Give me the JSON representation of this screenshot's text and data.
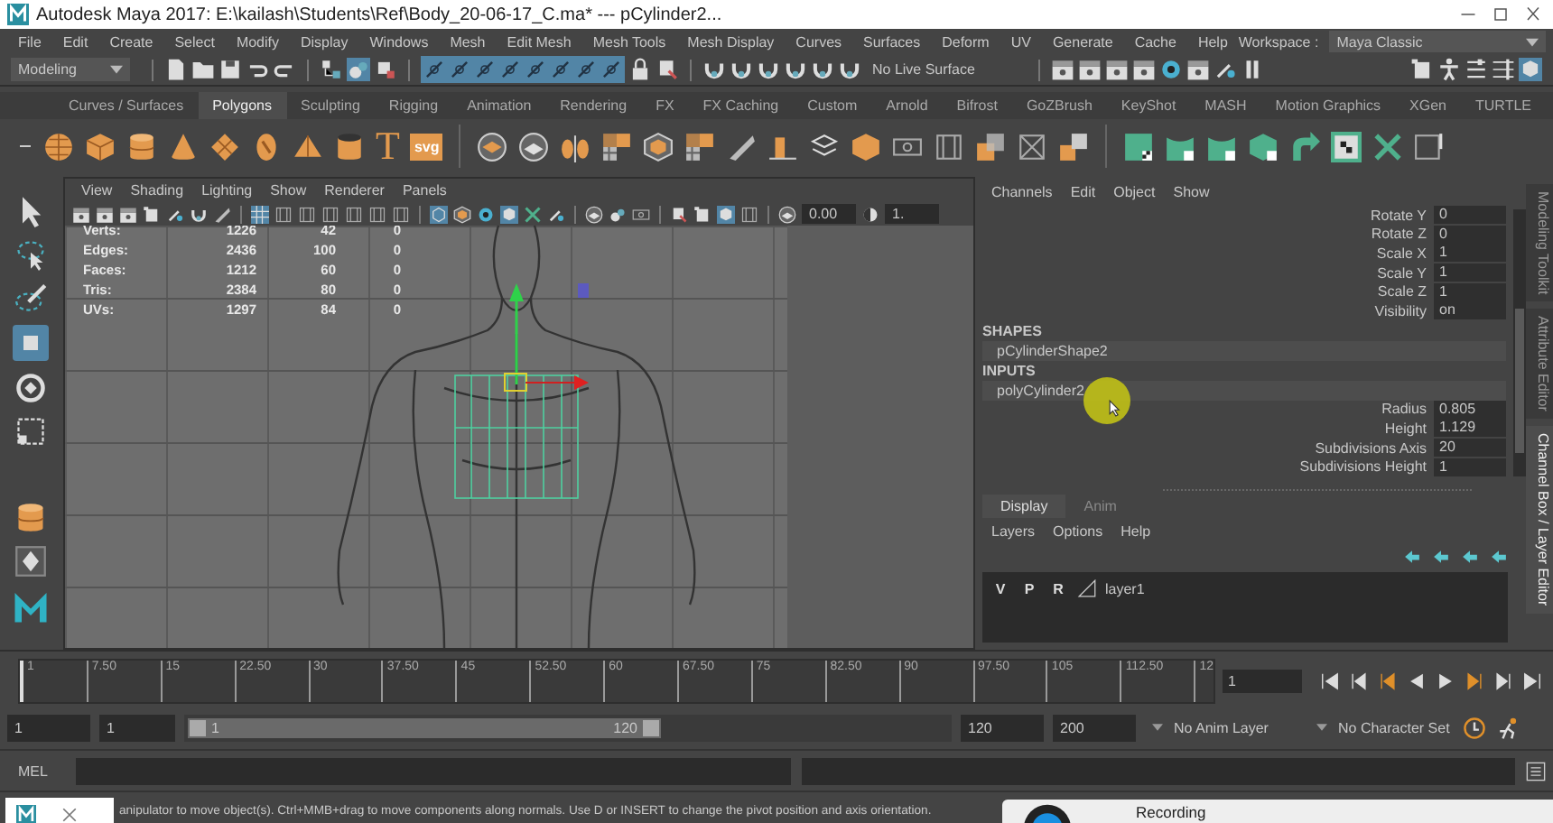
{
  "window": {
    "title": "Autodesk Maya 2017: E:\\kailash\\Students\\Ref\\Body_20-06-17_C.ma*  ---  pCylinder2..."
  },
  "menu_bar": {
    "items": [
      "File",
      "Edit",
      "Create",
      "Select",
      "Modify",
      "Display",
      "Windows",
      "Mesh",
      "Edit Mesh",
      "Mesh Tools",
      "Mesh Display",
      "Curves",
      "Surfaces",
      "Deform",
      "UV",
      "Generate",
      "Cache",
      "Help"
    ],
    "workspace_label": "Workspace :",
    "workspace": "Maya Classic"
  },
  "status_line": {
    "mode": "Modeling",
    "live_surface": "No Live Surface"
  },
  "shelf": {
    "tabs": [
      {
        "label": "Curves / Surfaces",
        "selected": false
      },
      {
        "label": "Polygons",
        "selected": true
      },
      {
        "label": "Sculpting",
        "selected": false
      },
      {
        "label": "Rigging",
        "selected": false
      },
      {
        "label": "Animation",
        "selected": false
      },
      {
        "label": "Rendering",
        "selected": false
      },
      {
        "label": "FX",
        "selected": false
      },
      {
        "label": "FX Caching",
        "selected": false
      },
      {
        "label": "Custom",
        "selected": false
      },
      {
        "label": "Arnold",
        "selected": false
      },
      {
        "label": "Bifrost",
        "selected": false
      },
      {
        "label": "GoZBrush",
        "selected": false
      },
      {
        "label": "KeyShot",
        "selected": false
      },
      {
        "label": "MASH",
        "selected": false
      },
      {
        "label": "Motion Graphics",
        "selected": false
      },
      {
        "label": "XGen",
        "selected": false
      },
      {
        "label": "TURTLE",
        "selected": false
      }
    ],
    "text_glyph": "T",
    "svg_label": "svg"
  },
  "viewport": {
    "menus": [
      "View",
      "Shading",
      "Lighting",
      "Show",
      "Renderer",
      "Panels"
    ],
    "exposure": "0.00",
    "gamma": "1.",
    "stats": [
      {
        "label": "Verts:",
        "values": [
          "1226",
          "42",
          "0"
        ]
      },
      {
        "label": "Edges:",
        "values": [
          "2436",
          "100",
          "0"
        ]
      },
      {
        "label": "Faces:",
        "values": [
          "1212",
          "60",
          "0"
        ]
      },
      {
        "label": "Tris:",
        "values": [
          "2384",
          "80",
          "0"
        ]
      },
      {
        "label": "UVs:",
        "values": [
          "1297",
          "84",
          "0"
        ]
      }
    ]
  },
  "channel_box": {
    "menus": [
      "Channels",
      "Edit",
      "Object",
      "Show"
    ],
    "attributes": [
      {
        "name": "Rotate Y",
        "value": "0"
      },
      {
        "name": "Rotate Z",
        "value": "0"
      },
      {
        "name": "Scale X",
        "value": "1"
      },
      {
        "name": "Scale Y",
        "value": "1"
      },
      {
        "name": "Scale Z",
        "value": "1"
      },
      {
        "name": "Visibility",
        "value": "on"
      }
    ],
    "shapes": {
      "heading": "SHAPES",
      "items": [
        "pCylinderShape2"
      ]
    },
    "inputs": {
      "heading": "INPUTS",
      "items": [
        "polyCylinder2"
      ],
      "attributes": [
        {
          "name": "Radius",
          "value": "0.805"
        },
        {
          "name": "Height",
          "value": "1.129"
        },
        {
          "name": "Subdivisions Axis",
          "value": "20"
        },
        {
          "name": "Subdivisions Height",
          "value": "1"
        }
      ]
    }
  },
  "layer_editor": {
    "tabs": [
      {
        "label": "Display",
        "selected": true
      },
      {
        "label": "Anim",
        "selected": false
      }
    ],
    "menus": [
      "Layers",
      "Options",
      "Help"
    ],
    "layers": [
      {
        "flags": [
          "V",
          "P",
          "R"
        ],
        "name": "layer1"
      }
    ]
  },
  "side_tabs": [
    {
      "label": "Modeling Toolkit",
      "selected": false
    },
    {
      "label": "Attribute Editor",
      "selected": false
    },
    {
      "label": "Channel Box / Layer Editor",
      "selected": true
    }
  ],
  "time_slider": {
    "ticks": [
      "1",
      "7.50",
      "15",
      "22.50",
      "30",
      "37.50",
      "45",
      "52.50",
      "60",
      "67.50",
      "75",
      "82.50",
      "90",
      "97.50",
      "105",
      "112.50",
      "12"
    ],
    "current_frame": "1"
  },
  "range_slider": {
    "start": "1",
    "range_start": "1",
    "bar_start": "1",
    "bar_end": "120",
    "range_end": "120",
    "end": "200",
    "anim_layer": "No Anim Layer",
    "character_set": "No Character Set"
  },
  "command_line": {
    "language": "MEL"
  },
  "help_line": {
    "text": "anipulator to move object(s). Ctrl+MMB+drag to move components along normals. Use D or INSERT to change the pivot position and axis orientation."
  },
  "recording_popup": {
    "label": "Recording"
  }
}
